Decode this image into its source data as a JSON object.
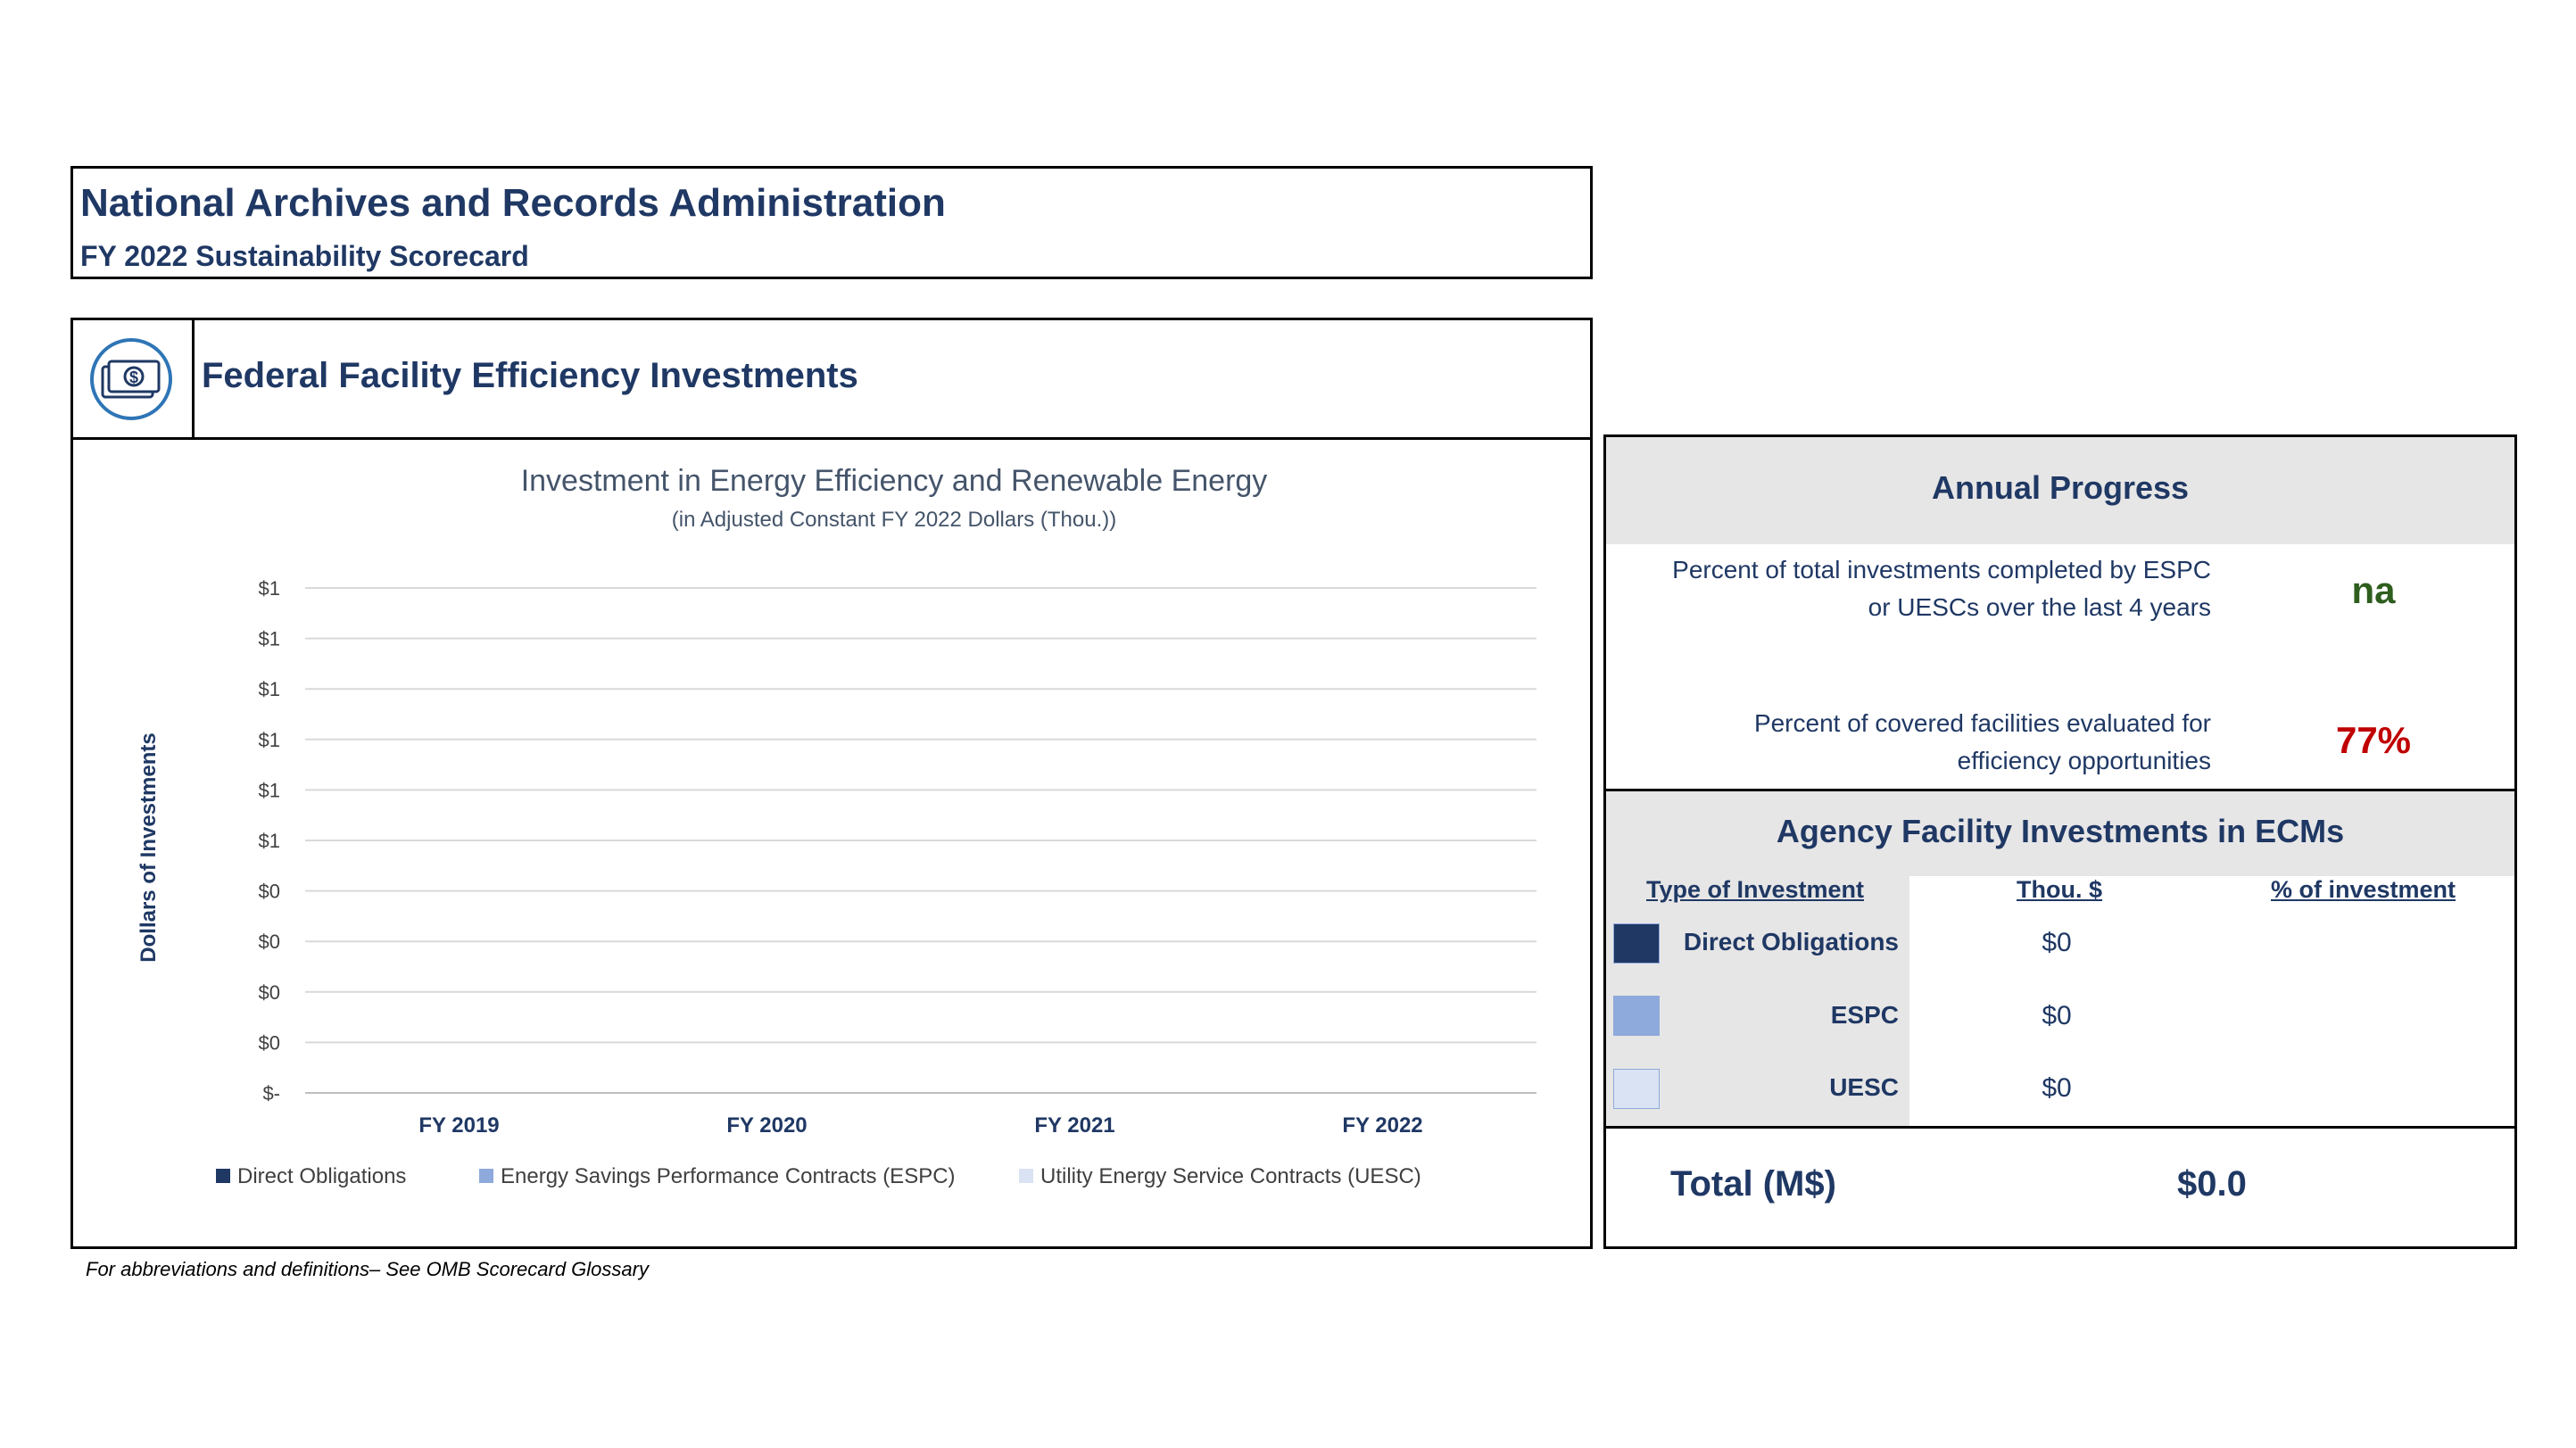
{
  "header": {
    "agency": "National Archives and Records Administration",
    "subtitle": "FY 2022 Sustainability Scorecard"
  },
  "section": {
    "title": "Federal Facility Efficiency Investments",
    "icon": "money-icon"
  },
  "chart_data": {
    "type": "bar",
    "stacked": true,
    "title": "Investment in Energy Efficiency and Renewable Energy",
    "subtitle": "(in Adjusted Constant FY 2022 Dollars (Thou.))",
    "ylabel": "Dollars of Investments",
    "xlabel": "",
    "categories": [
      "FY 2019",
      "FY 2020",
      "FY 2021",
      "FY 2022"
    ],
    "yticks": [
      "$-",
      "$0",
      "$0",
      "$0",
      "$0",
      "$1",
      "$1",
      "$1",
      "$1",
      "$1",
      "$1"
    ],
    "ylim": [
      0,
      1
    ],
    "grid": true,
    "legend_position": "bottom",
    "series": [
      {
        "name": "Direct Obligations",
        "values": [
          0,
          0,
          0,
          0
        ],
        "color": "#1f3864"
      },
      {
        "name": "Energy Savings Performance Contracts (ESPC)",
        "values": [
          0,
          0,
          0,
          0
        ],
        "color": "#8ea9db"
      },
      {
        "name": "Utility Energy Service Contracts (UESC)",
        "values": [
          0,
          0,
          0,
          0
        ],
        "color": "#dae3f3"
      }
    ]
  },
  "annual_progress": {
    "title": "Annual Progress",
    "metric1_label": "Percent of total investments completed by ESPC or UESCs over the last 4 years",
    "metric1_value": "na",
    "metric2_label": "Percent of covered facilities evaluated for efficiency opportunities",
    "metric2_value": "77%"
  },
  "ecm": {
    "title": "Agency Facility Investments in ECMs",
    "col_type": "Type of Investment",
    "col_thou": "Thou. $",
    "col_pct": "% of investment",
    "rows": [
      {
        "label": "Direct Obligations",
        "value": "$0",
        "color": "#1f3864"
      },
      {
        "label": "ESPC",
        "value": "$0",
        "color": "#8ea9db"
      },
      {
        "label": "UESC",
        "value": "$0",
        "color": "#dae3f3"
      }
    ],
    "total_label": "Total (M$)",
    "total_value": "$0.0"
  },
  "footnote": "For abbreviations and definitions– See OMB Scorecard Glossary"
}
